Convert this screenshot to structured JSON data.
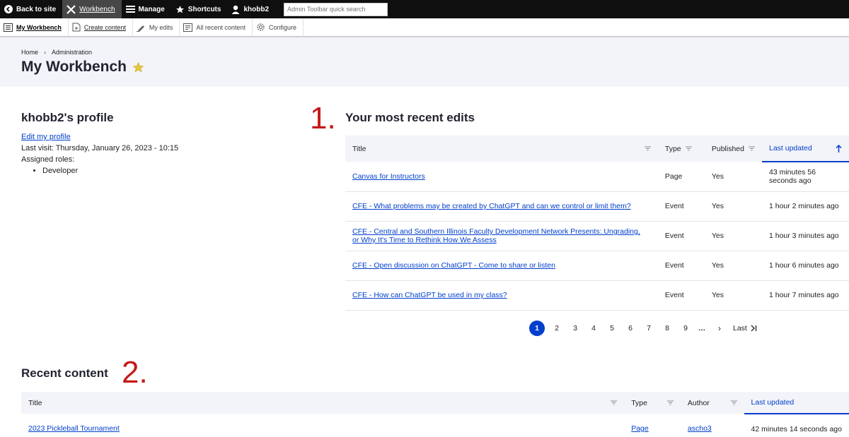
{
  "toolbar": {
    "back_to_site": "Back to site",
    "workbench": "Workbench",
    "manage": "Manage",
    "shortcuts": "Shortcuts",
    "user": "khobb2",
    "search_placeholder": "Admin Toolbar quick search"
  },
  "tray": {
    "my_workbench": "My Workbench",
    "create_content": "Create content",
    "my_edits": "My edits",
    "all_recent_content": "All recent content",
    "configure": "Configure"
  },
  "breadcrumb": {
    "home": "Home",
    "separator": "›",
    "administration": "Administration"
  },
  "page": {
    "title": "My Workbench"
  },
  "profile": {
    "title": "khobb2's profile",
    "edit_link": "Edit my profile",
    "last_visit": "Last visit: Thursday, January 26, 2023 - 10:15",
    "roles_label": "Assigned roles:",
    "roles": [
      "Developer"
    ]
  },
  "annotations": {
    "first": "1.",
    "second": "2."
  },
  "recent_edits": {
    "title": "Your most recent edits",
    "columns": {
      "title": "Title",
      "type": "Type",
      "published": "Published",
      "last_updated": "Last updated"
    },
    "rows": [
      {
        "title": "Canvas for Instructors",
        "title2": "",
        "type": "Page",
        "published": "Yes",
        "updated": "43 minutes 56",
        "updated2": "seconds ago"
      },
      {
        "title": "CFE - What problems may be created by ChatGPT and can we control or limit them?",
        "title2": "",
        "type": "Event",
        "published": "Yes",
        "updated": "1 hour 2 minutes ago",
        "updated2": ""
      },
      {
        "title": "CFE - Central and Southern Illinois Faculty Development Network Presents: Ungrading,",
        "title2": "or Why It's Time to Rethink How We Assess",
        "type": "Event",
        "published": "Yes",
        "updated": "1 hour 3 minutes ago",
        "updated2": ""
      },
      {
        "title": "CFE - Open discussion on ChatGPT - Come to share or listen",
        "title2": "",
        "type": "Event",
        "published": "Yes",
        "updated": "1 hour 6 minutes ago",
        "updated2": ""
      },
      {
        "title": "CFE - How can ChatGPT be used in my class?",
        "title2": "",
        "type": "Event",
        "published": "Yes",
        "updated": "1 hour 7 minutes ago",
        "updated2": ""
      }
    ]
  },
  "pager": {
    "current": "1",
    "pages": [
      "2",
      "3",
      "4",
      "5",
      "6",
      "7",
      "8",
      "9"
    ],
    "ellipsis": "…",
    "next": "›",
    "last": "Last"
  },
  "recent_content": {
    "title": "Recent content",
    "columns": {
      "title": "Title",
      "type": "Type",
      "author": "Author",
      "last_updated": "Last updated"
    },
    "rows": [
      {
        "title": "2023 Pickleball Tournament",
        "type": "Page",
        "author": "ascho3",
        "updated": "42 minutes 14 seconds ago"
      }
    ]
  },
  "colors": {
    "link": "#003ecc",
    "annotation": "#c41919",
    "header_bg": "#f3f4f9",
    "toolbar_bg": "#0f0f0f",
    "star": "#e5c53b"
  }
}
